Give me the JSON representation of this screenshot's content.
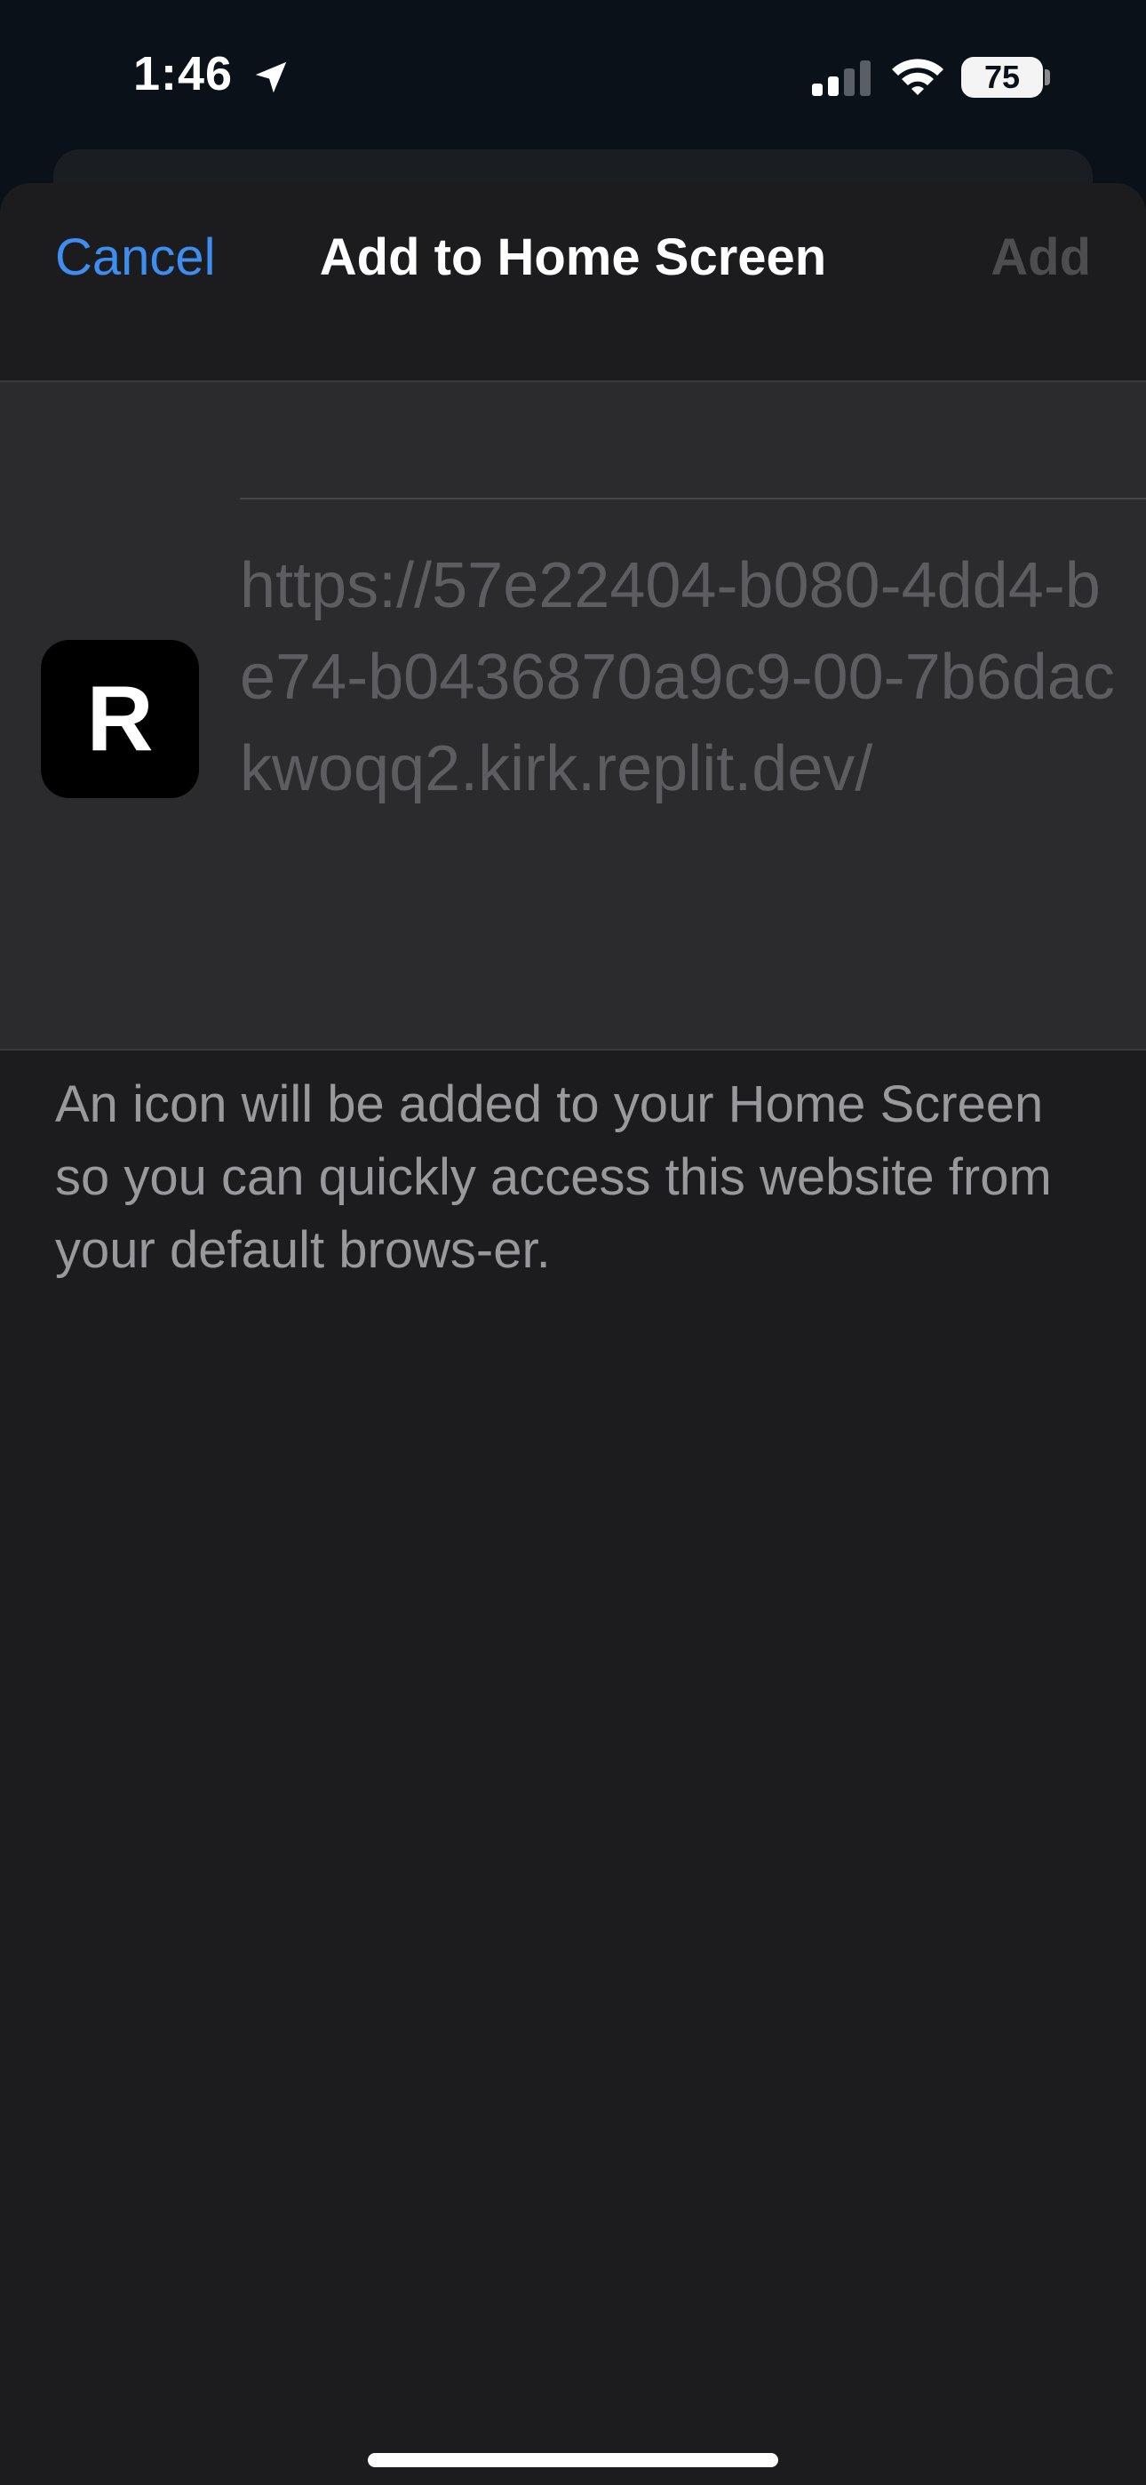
{
  "status_bar": {
    "time": "1:46",
    "battery": "75",
    "icons": [
      "location-arrow-icon",
      "cellular-signal-icon",
      "wifi-icon",
      "battery-icon"
    ]
  },
  "nav": {
    "cancel_label": "Cancel",
    "title": "Add to Home Screen",
    "add_label": "Add"
  },
  "shortcut": {
    "icon_letter": "R",
    "name_value": "",
    "url": "https://57e22404-b080-4dd4-be74-b0436870a9c9-00-7b6dackwoqq2.kirk.replit.dev/"
  },
  "footnote": "An icon will be added to your Home Screen so you can quickly access this website from your default brows-er.",
  "colors": {
    "accent": "#3d8ef0",
    "sheet_background": "#1c1c1e",
    "group_background": "#2b2b2e",
    "disabled_text": "#4d4d50"
  }
}
